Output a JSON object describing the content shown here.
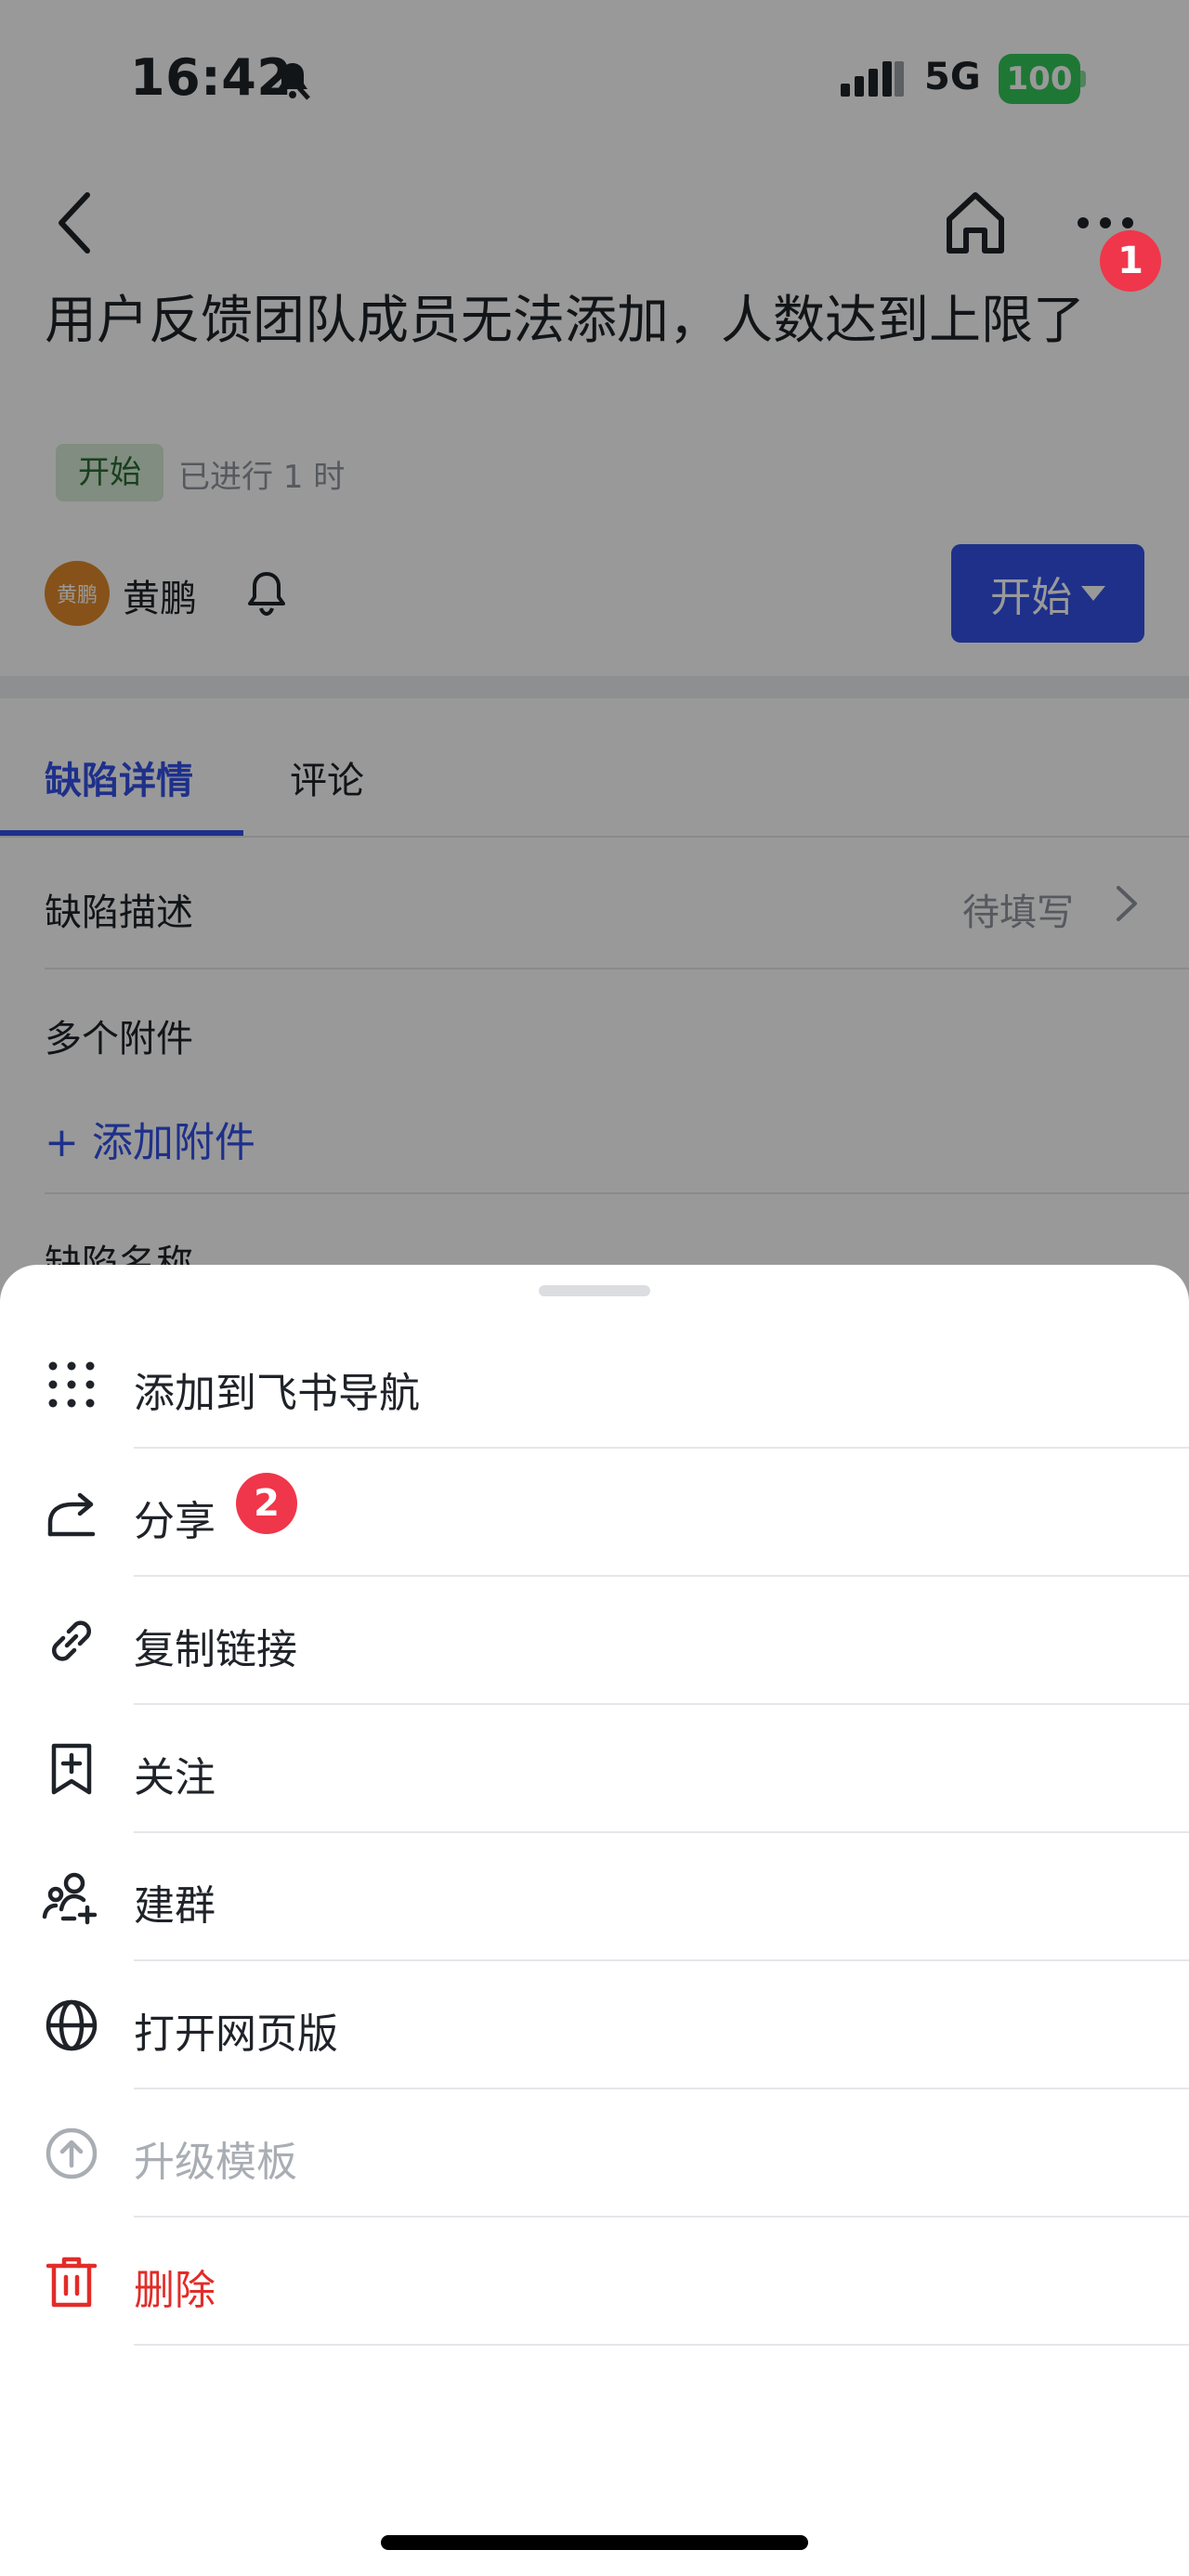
{
  "status_bar": {
    "time": "16:42",
    "network": "5G",
    "battery": "100"
  },
  "header": {
    "title": "用户反馈团队成员无法添加，人数达到上限了"
  },
  "issue": {
    "status_tag": "开始",
    "elapsed": "已进行 1 时",
    "assignee_avatar_text": "黄鹏",
    "assignee_name": "黄鹏",
    "state_button": "开始"
  },
  "tabs": [
    {
      "label": "缺陷详情",
      "active": true
    },
    {
      "label": "评论",
      "active": false
    }
  ],
  "fields": {
    "description_label": "缺陷描述",
    "description_value": "待填写",
    "attachments_label": "多个附件",
    "add_attachment": "+ 添加附件",
    "name_label": "缺陷名称"
  },
  "markers": {
    "first": "1",
    "second": "2"
  },
  "menu": {
    "items": [
      {
        "label": "添加到飞书导航",
        "icon": "grid-dots-icon",
        "state": "normal"
      },
      {
        "label": "分享",
        "icon": "share-icon",
        "state": "normal"
      },
      {
        "label": "复制链接",
        "icon": "link-icon",
        "state": "normal"
      },
      {
        "label": "关注",
        "icon": "bookmark-plus-icon",
        "state": "normal"
      },
      {
        "label": "建群",
        "icon": "add-group-icon",
        "state": "normal"
      },
      {
        "label": "打开网页版",
        "icon": "globe-icon",
        "state": "normal"
      },
      {
        "label": "升级模板",
        "icon": "upgrade-icon",
        "state": "disabled"
      },
      {
        "label": "删除",
        "icon": "trash-icon",
        "state": "danger"
      }
    ]
  },
  "colors": {
    "accent": "#3250e6",
    "danger": "#e22c28",
    "marker": "#f0364a",
    "tag_bg": "#d5ecd6"
  }
}
